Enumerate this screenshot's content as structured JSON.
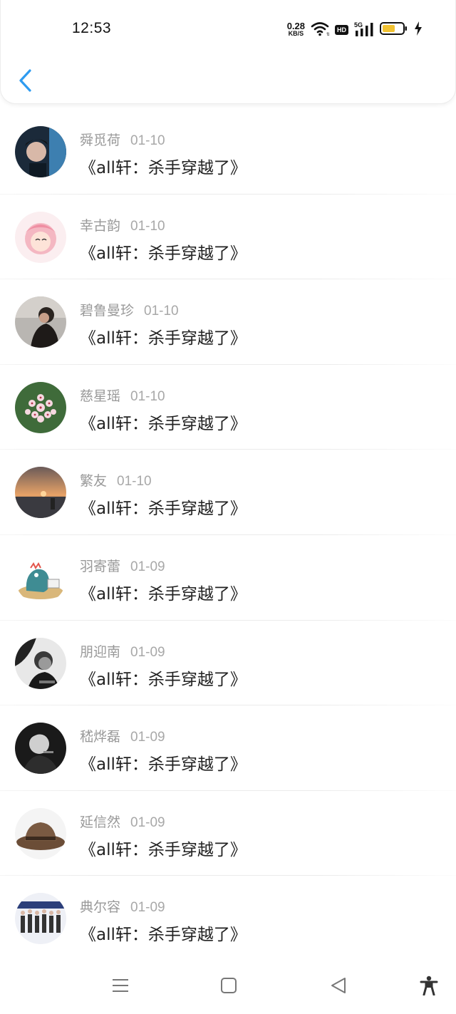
{
  "status_bar": {
    "time": "12:53",
    "net_speed_value": "0.28",
    "net_speed_unit": "KB/S",
    "hd_label": "HD",
    "signal_label": "5G"
  },
  "list": {
    "items": [
      {
        "name": "舜觅荷",
        "date": "01-10",
        "title": "《all轩：杀手穿越了》"
      },
      {
        "name": "幸古韵",
        "date": "01-10",
        "title": "《all轩：杀手穿越了》"
      },
      {
        "name": "碧鲁曼珍",
        "date": "01-10",
        "title": "《all轩：杀手穿越了》"
      },
      {
        "name": "慈星瑶",
        "date": "01-10",
        "title": "《all轩：杀手穿越了》"
      },
      {
        "name": "繁友",
        "date": "01-10",
        "title": "《all轩：杀手穿越了》"
      },
      {
        "name": "羽寄蕾",
        "date": "01-09",
        "title": "《all轩：杀手穿越了》"
      },
      {
        "name": "朋迎南",
        "date": "01-09",
        "title": "《all轩：杀手穿越了》"
      },
      {
        "name": "嵇烨磊",
        "date": "01-09",
        "title": "《all轩：杀手穿越了》"
      },
      {
        "name": "延信然",
        "date": "01-09",
        "title": "《all轩：杀手穿越了》"
      },
      {
        "name": "典尔容",
        "date": "01-09",
        "title": "《all轩：杀手穿越了》"
      }
    ]
  },
  "colors": {
    "accent": "#2e9bf0",
    "name_text": "#999999",
    "title_text": "#222222"
  },
  "icons": {
    "back": "chevron-left-icon",
    "menu": "menu-icon",
    "home": "home-icon",
    "nav_back": "triangle-back-icon",
    "accessibility": "accessibility-icon"
  }
}
